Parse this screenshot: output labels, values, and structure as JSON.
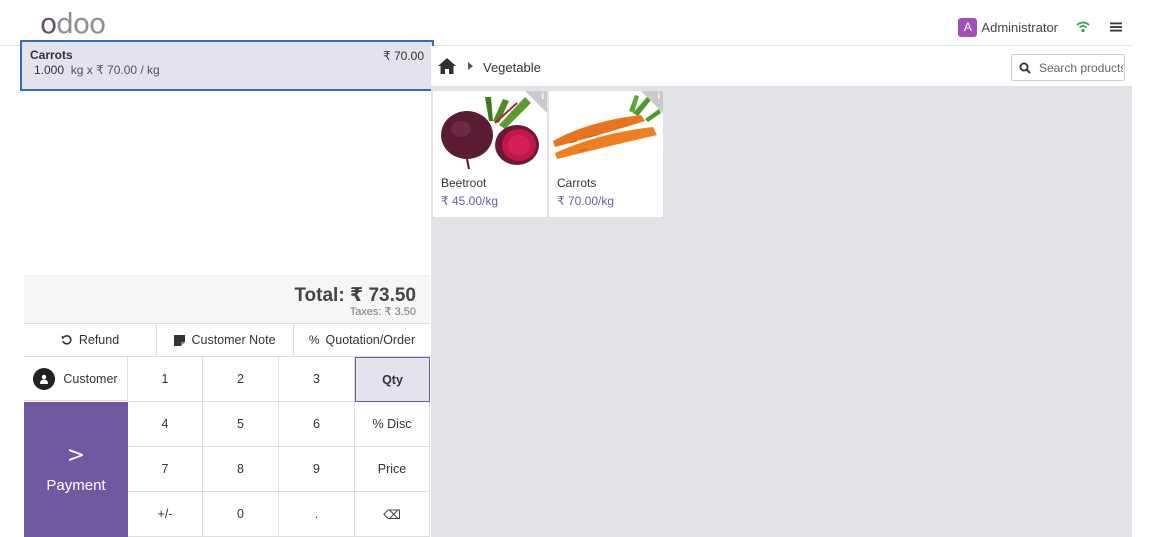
{
  "header": {
    "logo": "odoo",
    "user_initial": "A",
    "user_name": "Administrator",
    "icons": [
      "wifi-icon",
      "hamburger-menu-icon"
    ]
  },
  "order": {
    "lines": [
      {
        "name": "Carrots",
        "price": "₹ 70.00",
        "quantity": "1.000",
        "unit_detail": "kg x ₹ 70.00 / kg",
        "selected": true
      }
    ],
    "total_label": "Total: ₹ 73.50",
    "taxes_label": "Taxes: ₹ 3.50"
  },
  "actions": {
    "refund": "Refund",
    "customer_note": "Customer Note",
    "quotation": "Quotation/Order"
  },
  "numpad": {
    "customer": "Customer",
    "payment": "Payment",
    "payment_arrow": ">",
    "keys": [
      "1",
      "2",
      "3",
      "Qty",
      "4",
      "5",
      "6",
      "% Disc",
      "7",
      "8",
      "9",
      "Price",
      "+/-",
      "0",
      ".",
      "⌫"
    ],
    "selected_mode": "Qty"
  },
  "catalog": {
    "breadcrumb": "Vegetable",
    "search_placeholder": "Search products...",
    "products": [
      {
        "name": "Beetroot",
        "price": "₹ 45.00/kg"
      },
      {
        "name": "Carrots",
        "price": "₹ 70.00/kg"
      }
    ]
  },
  "colors": {
    "accent": "#6f5aa2",
    "selected_line_border": "#2f6fb3",
    "selected_bg": "#e4e2ec",
    "avatar": "#a04fb8",
    "wifi": "#28a745"
  }
}
